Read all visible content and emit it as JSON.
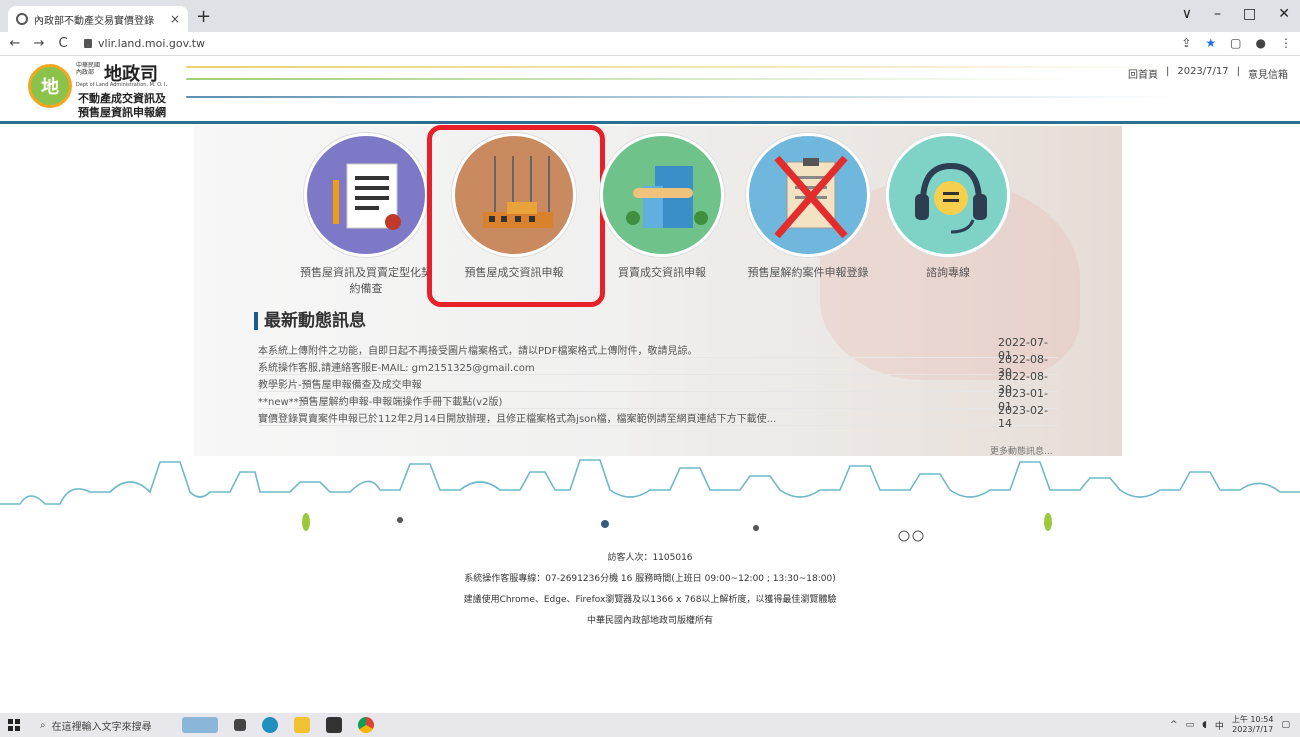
{
  "browser": {
    "tab_title": "內政部不動產交易實價登錄",
    "tab_close": "×",
    "new_tab": "+",
    "url": "vlir.land.moi.gov.tw",
    "back": "←",
    "forward": "→",
    "reload": "C",
    "window_controls": [
      "∨",
      "–",
      "□",
      "✕"
    ],
    "toolbar_icons": [
      "⇪",
      "★",
      "▢",
      "●",
      "⋮"
    ]
  },
  "header": {
    "logo_glyph": "地",
    "logo_small": "中華民國\n內政部",
    "dept_name": "地政司",
    "dept_en": "Dept of Land Administration, M. O. I.",
    "site_name_line1": "不動產成交資訊及",
    "site_name_line2": "預售屋資訊申報網",
    "links": [
      "回首頁",
      "|",
      "2023/7/17",
      "|",
      "意見信箱"
    ]
  },
  "services": [
    {
      "label": "預售屋資訊及買賣定型化契約備查",
      "icon": "contract-doc-icon"
    },
    {
      "label": "預售屋成交資訊申報",
      "icon": "construction-building-icon"
    },
    {
      "label": "買賣成交資訊申報",
      "icon": "handshake-building-icon"
    },
    {
      "label": "預售屋解約案件申報登錄",
      "icon": "cancelled-contract-icon"
    },
    {
      "label": "諮詢專線",
      "icon": "headset-support-icon"
    }
  ],
  "news": {
    "title": "最新動態訊息",
    "items": [
      {
        "text": "本系統上傳附件之功能，自即日起不再接受圖片檔案格式，請以PDF檔案格式上傳附件，敬請見諒。",
        "date": "2022-07-01"
      },
      {
        "text": "系統操作客服,請連絡客服E-MAIL: gm2151325@gmail.com",
        "date": "2022-08-30"
      },
      {
        "text": "教學影片-預售屋申報備查及成交申報",
        "date": "2022-08-30"
      },
      {
        "text": "**new**預售屋解約申報-申報端操作手冊下載點(v2版)",
        "date": "2023-01-01"
      },
      {
        "text": "實價登錄買賣案件申報已於112年2月14日開放辦理，且修正檔案格式為json檔，檔案範例請至網頁連結下方下載使...",
        "date": "2023-02-14"
      }
    ],
    "more": "更多動態訊息..."
  },
  "footer": {
    "visitors": "訪客人次：1105016",
    "hotline": "系統操作客服專線：07-2691236分機 16 服務時間(上班日 09:00~12:00 ; 13:30~18:00)",
    "browser_note": "建議使用Chrome、Edge、Firefox瀏覽器及以1366 x 768以上解析度，以獲得最佳瀏覽體驗",
    "copyright": "中華民國內政部地政司版權所有"
  },
  "taskbar": {
    "search_placeholder": "在這裡輸入文字來搜尋",
    "tray_ime": "中",
    "time": "上午 10:54",
    "date": "2023/7/17"
  },
  "colors": {
    "highlight": "#e8202a",
    "header_rule": "#2c6f93"
  }
}
